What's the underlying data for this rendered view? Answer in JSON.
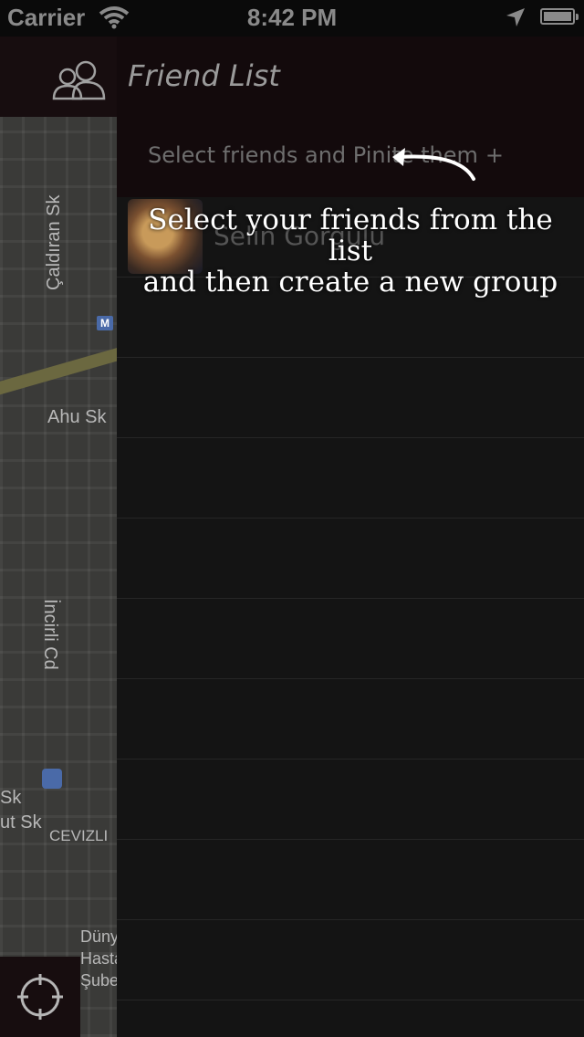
{
  "status_bar": {
    "carrier": "Carrier",
    "time": "8:42 PM",
    "icons": [
      "wifi-icon",
      "location-arrow-icon",
      "battery-icon"
    ]
  },
  "map": {
    "labels": [
      "Çaldıran Sk",
      "Ahu Sk",
      "İncirli Cd",
      "Sk",
      "ut Sk",
      "CEVIZLI",
      "Dünya",
      "Hasta",
      "Şube"
    ],
    "metro_badge": "M",
    "road_color": "#6b6840"
  },
  "panel": {
    "title": "Friend List",
    "title_icon": "friends-group-icon",
    "select_prompt": "Select friends and Pinite them",
    "select_plus": "+",
    "friends": [
      {
        "name": "Selin Gorgulu"
      }
    ],
    "empty_rows": 9
  },
  "coach_mark": {
    "line1": "Select your friends from the list",
    "line2": "and then create a new group",
    "arrow_icon": "curved-arrow-icon"
  },
  "controls": {
    "locate_icon": "crosshair-icon"
  },
  "colors": {
    "header_bg": "#130a0c",
    "panel_bg": "#141414",
    "divider": "#262626"
  }
}
